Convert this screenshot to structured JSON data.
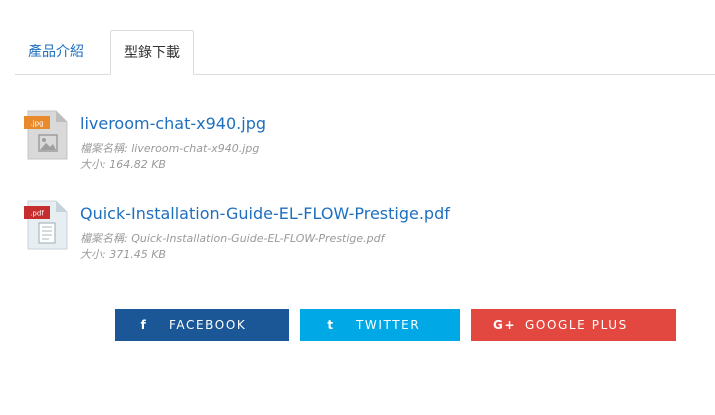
{
  "tabs": [
    {
      "label": "產品介紹"
    },
    {
      "label": "型錄下載"
    }
  ],
  "files": [
    {
      "icon_label": ".jpg",
      "icon": "image-file-icon",
      "link": "liveroom-chat-x940.jpg",
      "name_text": "檔案名稱: liveroom-chat-x940.jpg",
      "size_text": "大小: 164.82 KB"
    },
    {
      "icon_label": ".pdf",
      "icon": "pdf-file-icon",
      "link": "Quick-Installation-Guide-EL-FLOW-Prestige.pdf",
      "name_text": "檔案名稱: Quick-Installation-Guide-EL-FLOW-Prestige.pdf",
      "size_text": "大小: 371.45 KB"
    }
  ],
  "share": {
    "facebook": {
      "icon": "f",
      "label": "FACEBOOK",
      "color": "#1b5796"
    },
    "twitter": {
      "icon": "t",
      "label": "TWITTER",
      "color": "#00a8e6"
    },
    "google": {
      "icon": "G+",
      "label": "GOOGLE PLUS",
      "color": "#e2483f"
    }
  },
  "colors": {
    "link": "#1e6fbf",
    "meta": "#9a9a9a",
    "jpg_badge": "#e8892b",
    "pdf_badge": "#c62d2d"
  }
}
